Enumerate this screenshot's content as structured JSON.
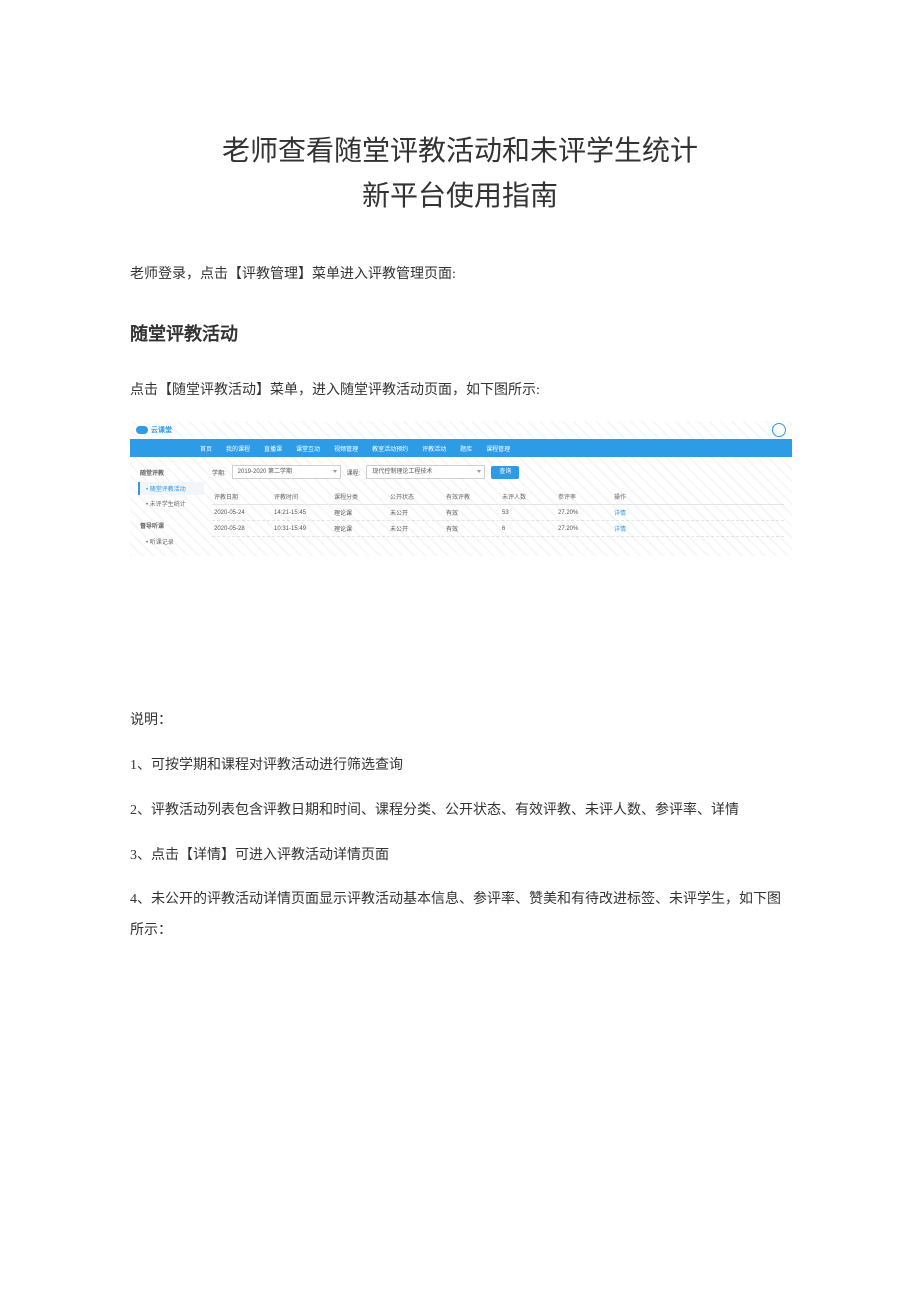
{
  "document": {
    "title_line1": "老师查看随堂评教活动和未评学生统计",
    "title_line2": "新平台使用指南",
    "intro": "老师登录，点击【评教管理】菜单进入评教管理页面:",
    "section_heading": "随堂评教活动",
    "section_intro": "点击【随堂评教活动】菜单，进入随堂评教活动页面，如下图所示:",
    "notes_header": "说明：",
    "notes": [
      "1、可按学期和课程对评教活动进行筛选查询",
      "2、评教活动列表包含评教日期和时间、课程分类、公开状态、有效评教、未评人数、参评率、详情",
      "3、点击【详情】可进入评教活动详情页面",
      "4、未公开的评教活动详情页面显示评教活动基本信息、参评率、赞美和有待改进标签、未评学生，如下图所示："
    ]
  },
  "screenshot": {
    "logo_text": "云课堂",
    "topnav": [
      "首页",
      "我的课程",
      "直播课",
      "课堂互动",
      "视频管理",
      "教室活动预约",
      "评教活动",
      "题库",
      "课程管理"
    ],
    "sidebar": {
      "group1_title": "随堂评教",
      "group1_items": [
        "• 随堂评教活动",
        "• 未评学生统计"
      ],
      "group2_title": "督导听课",
      "group2_items": [
        "• 听课记录"
      ]
    },
    "filter": {
      "label_term": "学期:",
      "term_value": "2019-2020 第二学期",
      "label_course": "课程:",
      "course_value": "现代控制理论工程技术",
      "search_btn": "查询"
    },
    "table": {
      "headers": {
        "date": "评教日期",
        "time": "评教时间",
        "cat": "课程分类",
        "open": "公开状态",
        "eff": "有效评教",
        "no": "未评人数",
        "rate": "参评率",
        "op": "操作"
      },
      "rows": [
        {
          "date": "2020-05-24",
          "time": "14:21-15:45",
          "cat": "理论课",
          "open": "未公开",
          "eff": "有效",
          "no": "53",
          "rate": "27.20%",
          "op": "详情"
        },
        {
          "date": "2020-05-28",
          "time": "10:31-15:49",
          "cat": "理论课",
          "open": "未公开",
          "eff": "有效",
          "no": "6",
          "rate": "27.20%",
          "op": "详情"
        }
      ]
    }
  }
}
